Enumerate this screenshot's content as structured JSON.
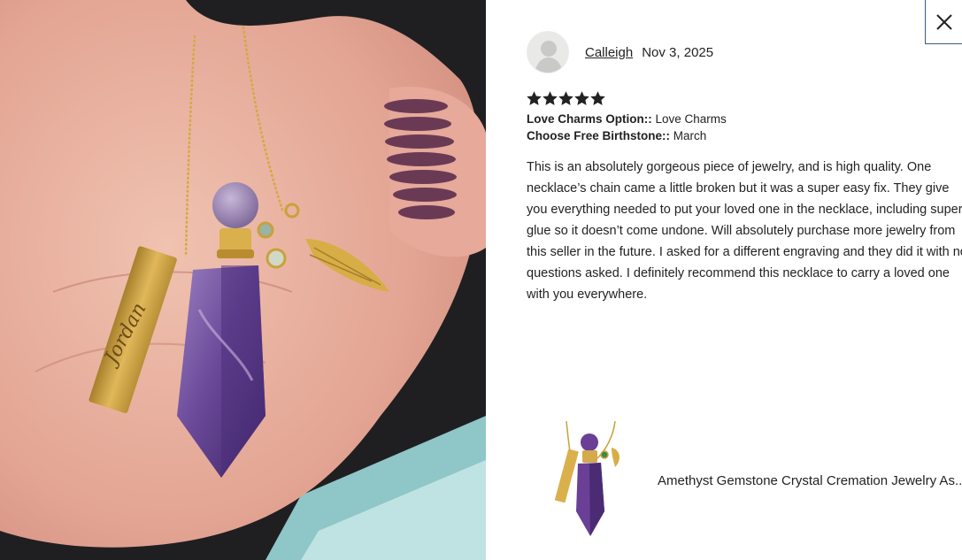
{
  "photo": {
    "engraving": "Jordan"
  },
  "close": {
    "icon": "close-icon"
  },
  "review": {
    "reviewer_name": "Calleigh",
    "date": "Nov 3, 2025",
    "rating": 5,
    "max_rating": 5,
    "options": [
      {
        "label": "Love Charms Option::",
        "value": " Love Charms"
      },
      {
        "label": "Choose Free Birthstone::",
        "value": " March"
      }
    ],
    "text": "This is an absolutely gorgeous piece of jewelry, and is high quality. One necklace’s chain came a little broken but it was a super easy fix. They give you everything needed to put your loved one in the necklace, including super glue so it doesn’t come undone. Will absolutely purchase more jewelry from this seller in the future. I asked for a different engraving and they did it with no questions asked. I definitely recommend this necklace to carry a loved one with you everywhere."
  },
  "product": {
    "title": "Amethyst Gemstone Crystal Cremation Jewelry As..."
  },
  "colors": {
    "border_accent": "#3b5a86",
    "text": "#222222",
    "amethyst": "#6a3f96",
    "gold": "#c9a13a"
  }
}
